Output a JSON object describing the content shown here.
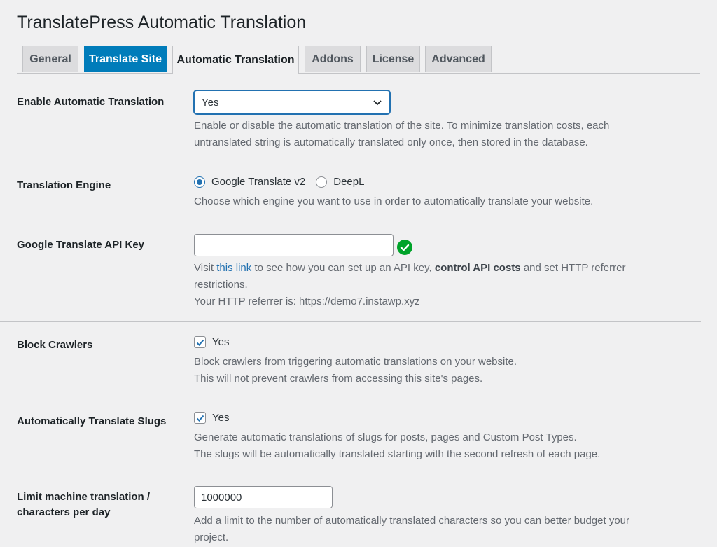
{
  "page_title": "TranslatePress Automatic Translation",
  "tabs": [
    {
      "label": "General"
    },
    {
      "label": "Translate Site"
    },
    {
      "label": "Automatic Translation"
    },
    {
      "label": "Addons"
    },
    {
      "label": "License"
    },
    {
      "label": "Advanced"
    }
  ],
  "enable_auto": {
    "label": "Enable Automatic Translation",
    "value": "Yes",
    "desc_line1": "Enable or disable the automatic translation of the site. To minimize translation costs, each",
    "desc_line2": "untranslated string is automatically translated only once, then stored in the database."
  },
  "engine": {
    "label": "Translation Engine",
    "options": [
      "Google Translate v2",
      "DeepL"
    ],
    "selected": "Google Translate v2",
    "desc": "Choose which engine you want to use in order to automatically translate your website."
  },
  "api_key": {
    "label": "Google Translate API Key",
    "value": "",
    "visit": "Visit",
    "link_text": "this link",
    "desc_mid": "to see how you can set up an API key,",
    "desc_bold": "control API costs",
    "desc_end": "and set HTTP referrer",
    "desc_line2": "restrictions.",
    "referrer": "Your HTTP referrer is: https://demo7.instawp.xyz",
    "status_icon": "check-circle-icon",
    "status_color": "#00a32a"
  },
  "block_crawlers": {
    "label": "Block Crawlers",
    "checkbox_label": "Yes",
    "checked": true,
    "desc_line1": "Block crawlers from triggering automatic translations on your website.",
    "desc_line2": "This will not prevent crawlers from accessing this site's pages."
  },
  "translate_slugs": {
    "label": "Automatically Translate Slugs",
    "checkbox_label": "Yes",
    "checked": true,
    "desc_line1": "Generate automatic translations of slugs for posts, pages and Custom Post Types.",
    "desc_line2": "The slugs will be automatically translated starting with the second refresh of each page."
  },
  "limit": {
    "label_line1": "Limit machine translation /",
    "label_line2": "characters per day",
    "value": "1000000",
    "desc_line1": "Add a limit to the number of automatically translated characters so you can better budget your",
    "desc_line2": "project."
  },
  "colors": {
    "accent": "#007cba",
    "link": "#2271b1",
    "success": "#00a32a"
  }
}
